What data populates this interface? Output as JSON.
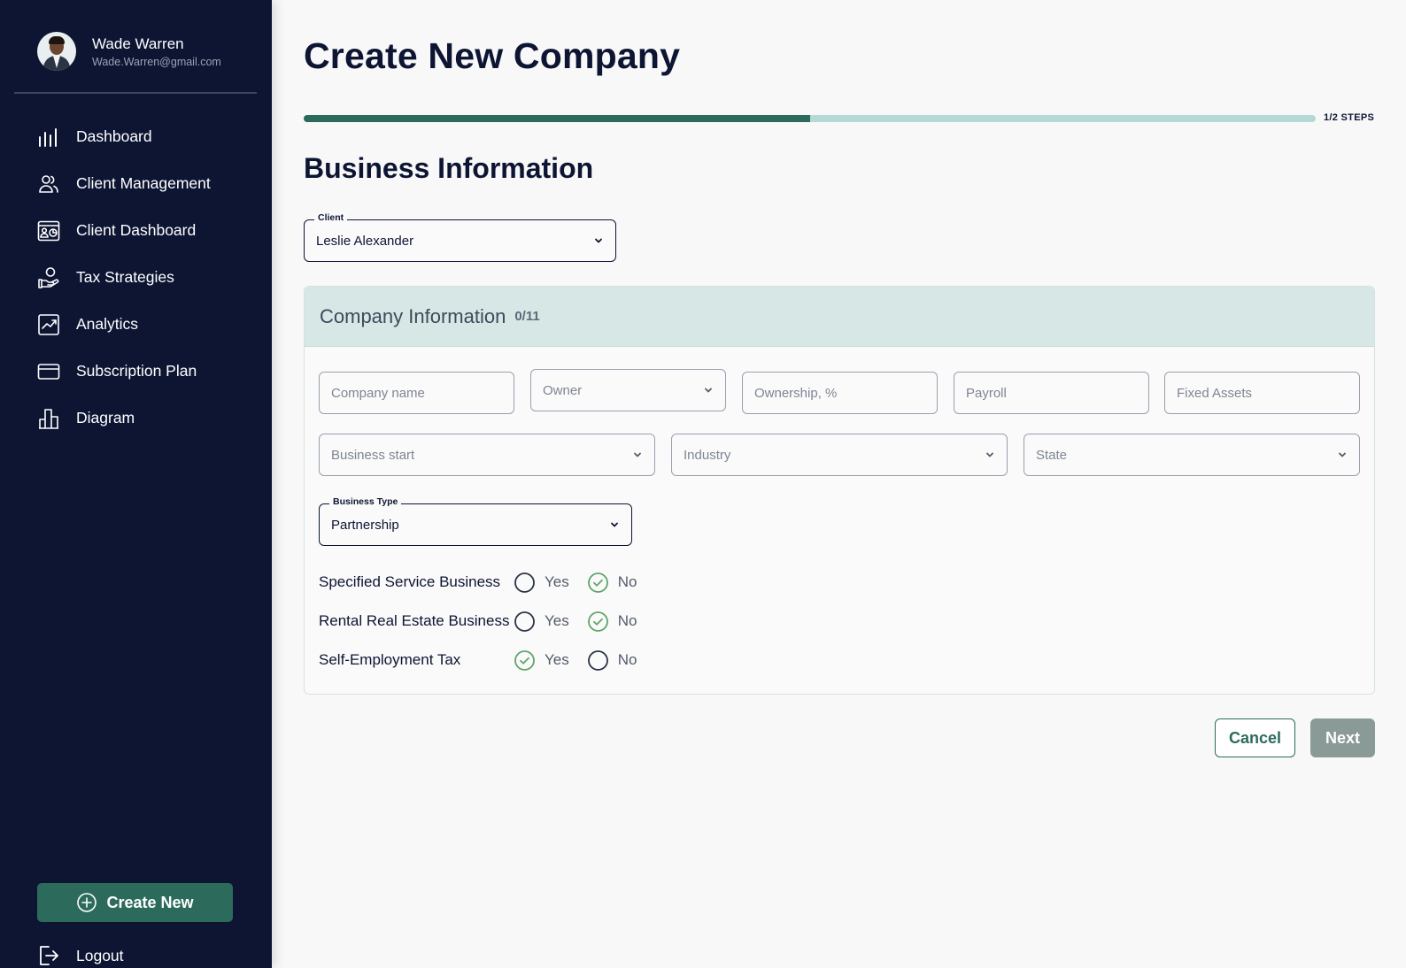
{
  "user": {
    "name": "Wade Warren",
    "email": "Wade.Warren@gmail.com"
  },
  "sidebar": {
    "items": [
      {
        "label": "Dashboard",
        "icon": "bar-chart-icon"
      },
      {
        "label": "Client Management",
        "icon": "users-icon"
      },
      {
        "label": "Client Dashboard",
        "icon": "client-dashboard-icon"
      },
      {
        "label": "Tax Strategies",
        "icon": "hand-coin-icon"
      },
      {
        "label": "Analytics",
        "icon": "trending-chart-icon"
      },
      {
        "label": "Subscription Plan",
        "icon": "credit-card-icon"
      },
      {
        "label": "Diagram",
        "icon": "diagram-icon"
      }
    ],
    "create_new": "Create New",
    "logout": "Logout"
  },
  "page": {
    "title": "Create New Company",
    "progress_fraction": 0.5,
    "steps": "1/2 STEPS",
    "section_title": "Business Information"
  },
  "client_field": {
    "label": "Client",
    "value": "Leslie Alexander"
  },
  "company_info": {
    "title": "Company Information",
    "count": "0/11",
    "fields": {
      "company_name": "Company name",
      "owner": "Owner",
      "ownership": "Ownership, %",
      "payroll": "Payroll",
      "fixed_assets": "Fixed Assets",
      "business_start": "Business start",
      "industry": "Industry",
      "state": "State"
    },
    "business_type": {
      "label": "Business Type",
      "value": "Partnership"
    },
    "questions": [
      {
        "label": "Specified Service Business",
        "yes": "Yes",
        "no": "No",
        "selected": "No"
      },
      {
        "label": "Rental Real Estate Business",
        "yes": "Yes",
        "no": "No",
        "selected": "No"
      },
      {
        "label": "Self-Employment Tax",
        "yes": "Yes",
        "no": "No",
        "selected": "Yes"
      }
    ]
  },
  "actions": {
    "cancel": "Cancel",
    "next": "Next"
  },
  "colors": {
    "sidebar_bg": "#0d1533",
    "accent": "#2c6b5c",
    "progress_track": "#b5d9d5",
    "card_header": "#d6e7e6",
    "check": "#5fa56b"
  }
}
